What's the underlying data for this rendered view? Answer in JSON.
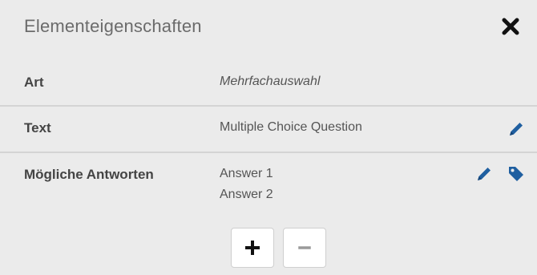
{
  "panel": {
    "title": "Elementeigenschaften",
    "close_icon": "close-icon"
  },
  "properties": {
    "art": {
      "label": "Art",
      "value": "Mehrfachauswahl"
    },
    "text": {
      "label": "Text",
      "value": "Multiple Choice Question",
      "action_icon": "pencil-icon"
    },
    "answers": {
      "label": "Mögliche Antworten",
      "items": [
        "Answer 1",
        "Answer 2"
      ],
      "action_icons": [
        "pencil-icon",
        "tag-icon"
      ],
      "add_icon": "plus-icon",
      "remove_icon": "minus-icon"
    }
  },
  "colors": {
    "background": "#ebebeb",
    "accent": "#1f5fa0",
    "label": "#444444",
    "title": "#6b6b6b"
  }
}
